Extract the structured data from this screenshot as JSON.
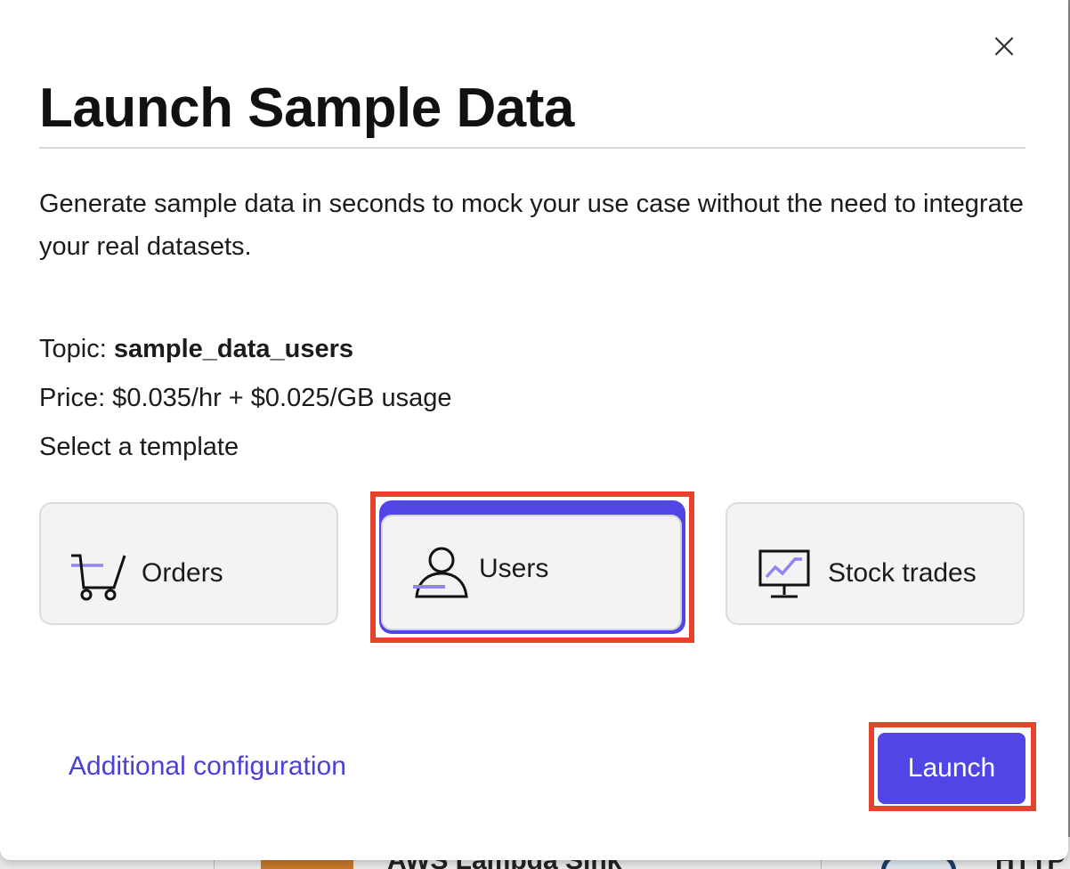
{
  "modal": {
    "title": "Launch Sample Data",
    "description": "Generate sample data in seconds to mock your use case without the need to integrate your real datasets.",
    "topic_label": "Topic: ",
    "topic_value": "sample_data_users",
    "price": "Price: $0.035/hr + $0.025/GB usage",
    "select_template": "Select a template",
    "templates": [
      {
        "label": "Orders",
        "icon": "shopping-cart-icon",
        "selected": false
      },
      {
        "label": "Users",
        "icon": "user-icon",
        "selected": true
      },
      {
        "label": "Stock trades",
        "icon": "stock-monitor-icon",
        "selected": false
      }
    ],
    "additional_config_label": "Additional configuration",
    "launch_label": "Launch"
  },
  "background": {
    "peek_text": "AWS Lambda Sink",
    "peek_text_right": "HTTP"
  },
  "colors": {
    "accent": "#5046e5",
    "link": "#4a3fd6",
    "annotation": "#e5432e",
    "card_bg": "#f3f3f3",
    "icon_accent": "#8f86f0"
  }
}
